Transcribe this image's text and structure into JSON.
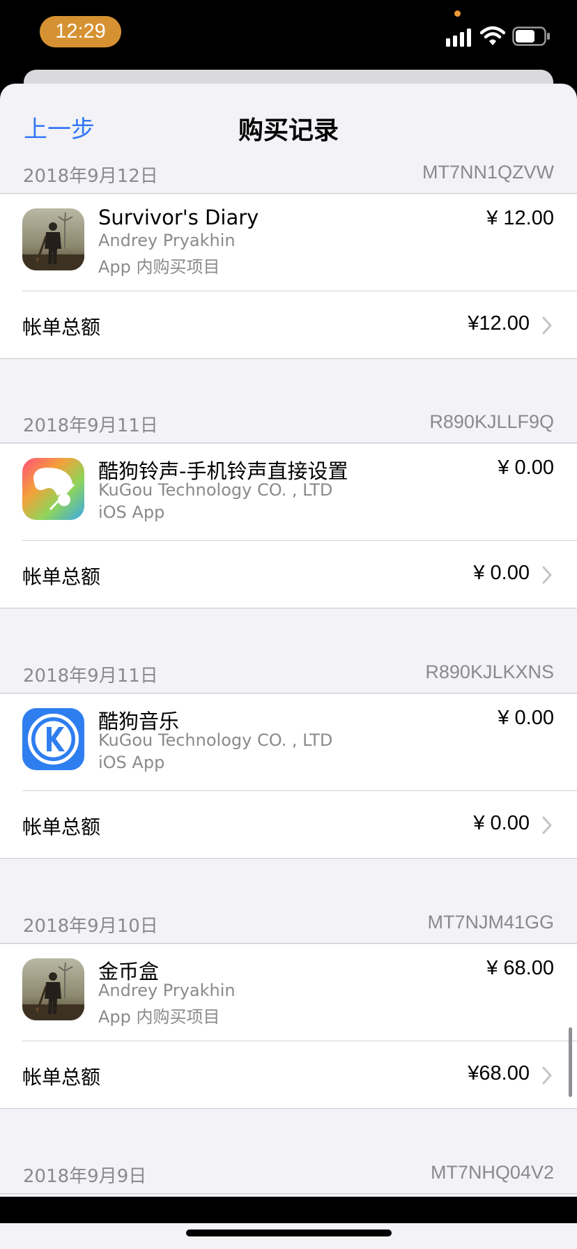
{
  "status_bar": {
    "time": "12:29",
    "icons": [
      "signal-icon",
      "wifi-icon",
      "battery-icon"
    ],
    "time_pill_color": "#d69232"
  },
  "nav": {
    "back_label": "上一步",
    "title": "购买记录",
    "accent_color": "#3478f6"
  },
  "sections": [
    {
      "date": "2018年9月12日",
      "order_id": "MT7NN1QZVW",
      "item": {
        "icon": "survivor-game-icon",
        "title": "Survivor's Diary",
        "developer": "Andrey Pryakhin",
        "type": "App 内购买项目",
        "price": "¥ 12.00"
      },
      "total_label": "帐单总额",
      "total_amount": "¥12.00"
    },
    {
      "date": "2018年9月11日",
      "order_id": "R890KJLLF9Q",
      "item": {
        "icon": "kugou-ringtone-icon",
        "title": "酷狗铃声-手机铃声直接设置",
        "developer": "KuGou Technology CO. , LTD",
        "type": "iOS App",
        "price": "¥ 0.00"
      },
      "total_label": "帐单总额",
      "total_amount": "¥ 0.00"
    },
    {
      "date": "2018年9月11日",
      "order_id": "R890KJLKXNS",
      "item": {
        "icon": "kugou-music-icon",
        "title": "酷狗音乐",
        "developer": "KuGou Technology CO. , LTD",
        "type": "iOS App",
        "price": "¥ 0.00"
      },
      "total_label": "帐单总额",
      "total_amount": "¥ 0.00"
    },
    {
      "date": "2018年9月10日",
      "order_id": "MT7NJM41GG",
      "item": {
        "icon": "survivor-game-icon",
        "title": "金币盒",
        "developer": "Andrey Pryakhin",
        "type": "App 内购买项目",
        "price": "¥ 68.00"
      },
      "total_label": "帐单总额",
      "total_amount": "¥68.00"
    }
  ],
  "partial_section": {
    "date": "2018年9月9日",
    "order_id": "MT7NHQ04V2"
  }
}
